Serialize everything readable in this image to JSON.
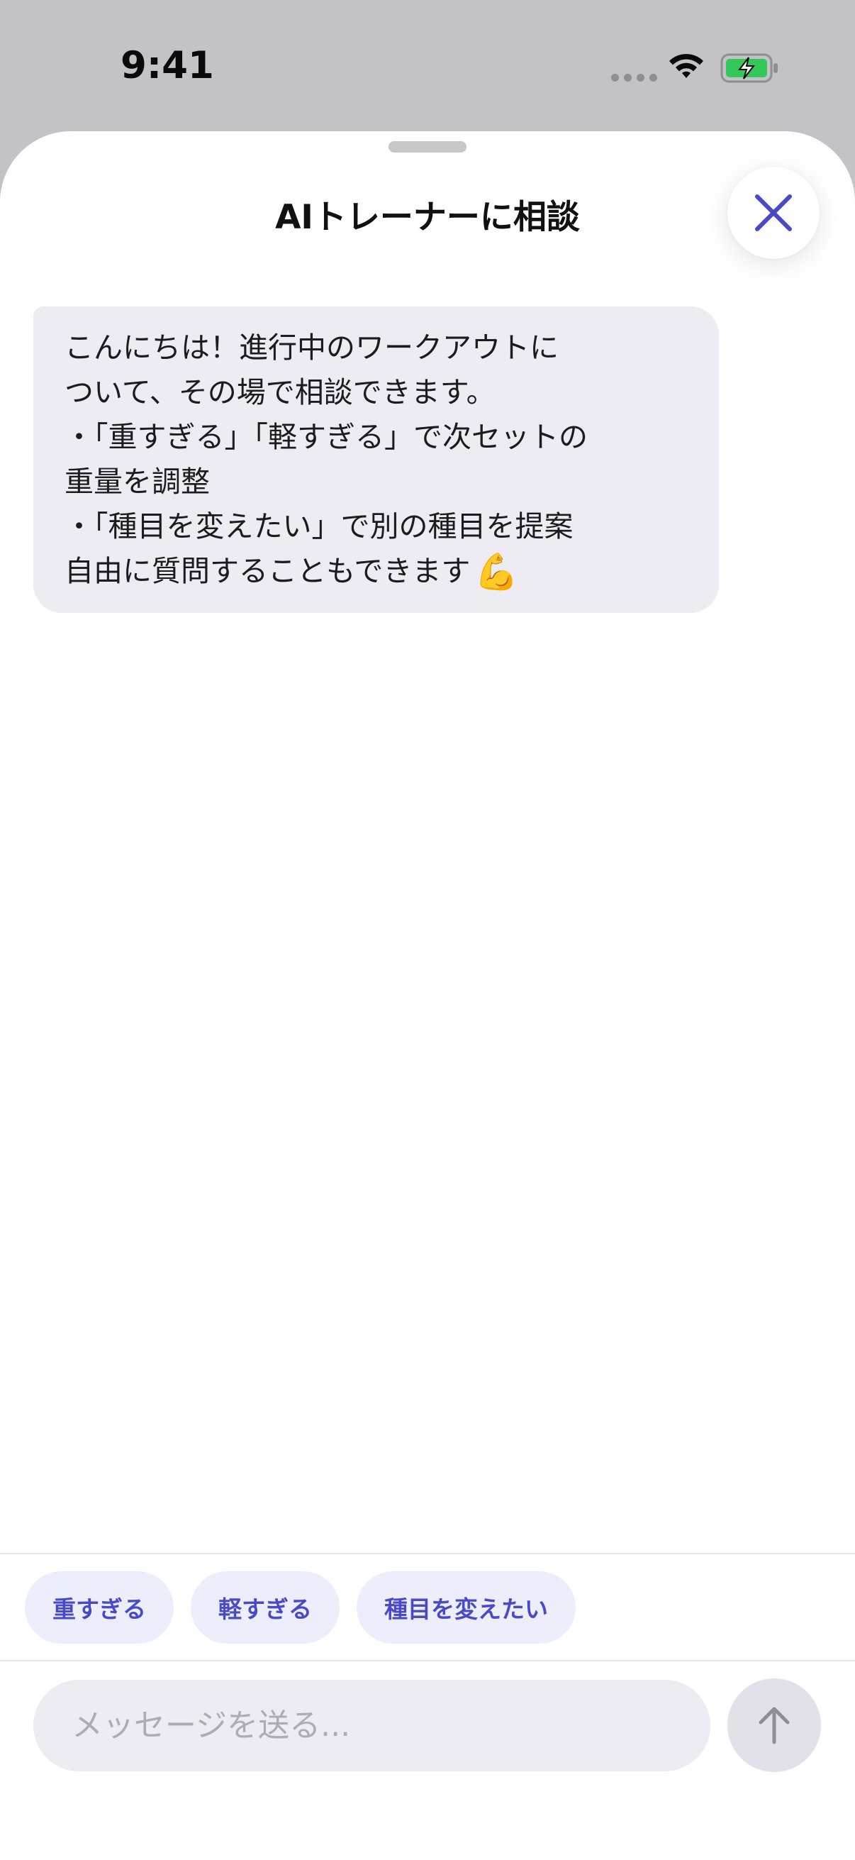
{
  "status_bar": {
    "time": "9:41"
  },
  "sheet": {
    "title": "AIトレーナーに相談"
  },
  "messages": [
    {
      "role": "assistant",
      "lines": [
        "こんにちは！進行中のワークアウトに",
        "ついて、その場で相談できます。",
        "・「重すぎる」「軽すぎる」で次セットの",
        "重量を調整",
        "・「種目を変えたい」で別の種目を提案",
        "自由に質問することもできます"
      ],
      "emoji": "💪"
    }
  ],
  "quick_replies": [
    "重すぎる",
    "軽すぎる",
    "種目を変えたい"
  ],
  "composer": {
    "placeholder": "メッセージを送る...",
    "value": ""
  },
  "icons": {
    "close": "close-icon",
    "send": "arrow-up-icon",
    "wifi": "wifi-icon",
    "battery": "battery-charging-icon",
    "signal": "cellular-signal-icon"
  },
  "colors": {
    "accent": "#4a4ac6",
    "bubble": "#ececf2",
    "chip_bg": "#eceefb",
    "battery": "#34c759"
  }
}
